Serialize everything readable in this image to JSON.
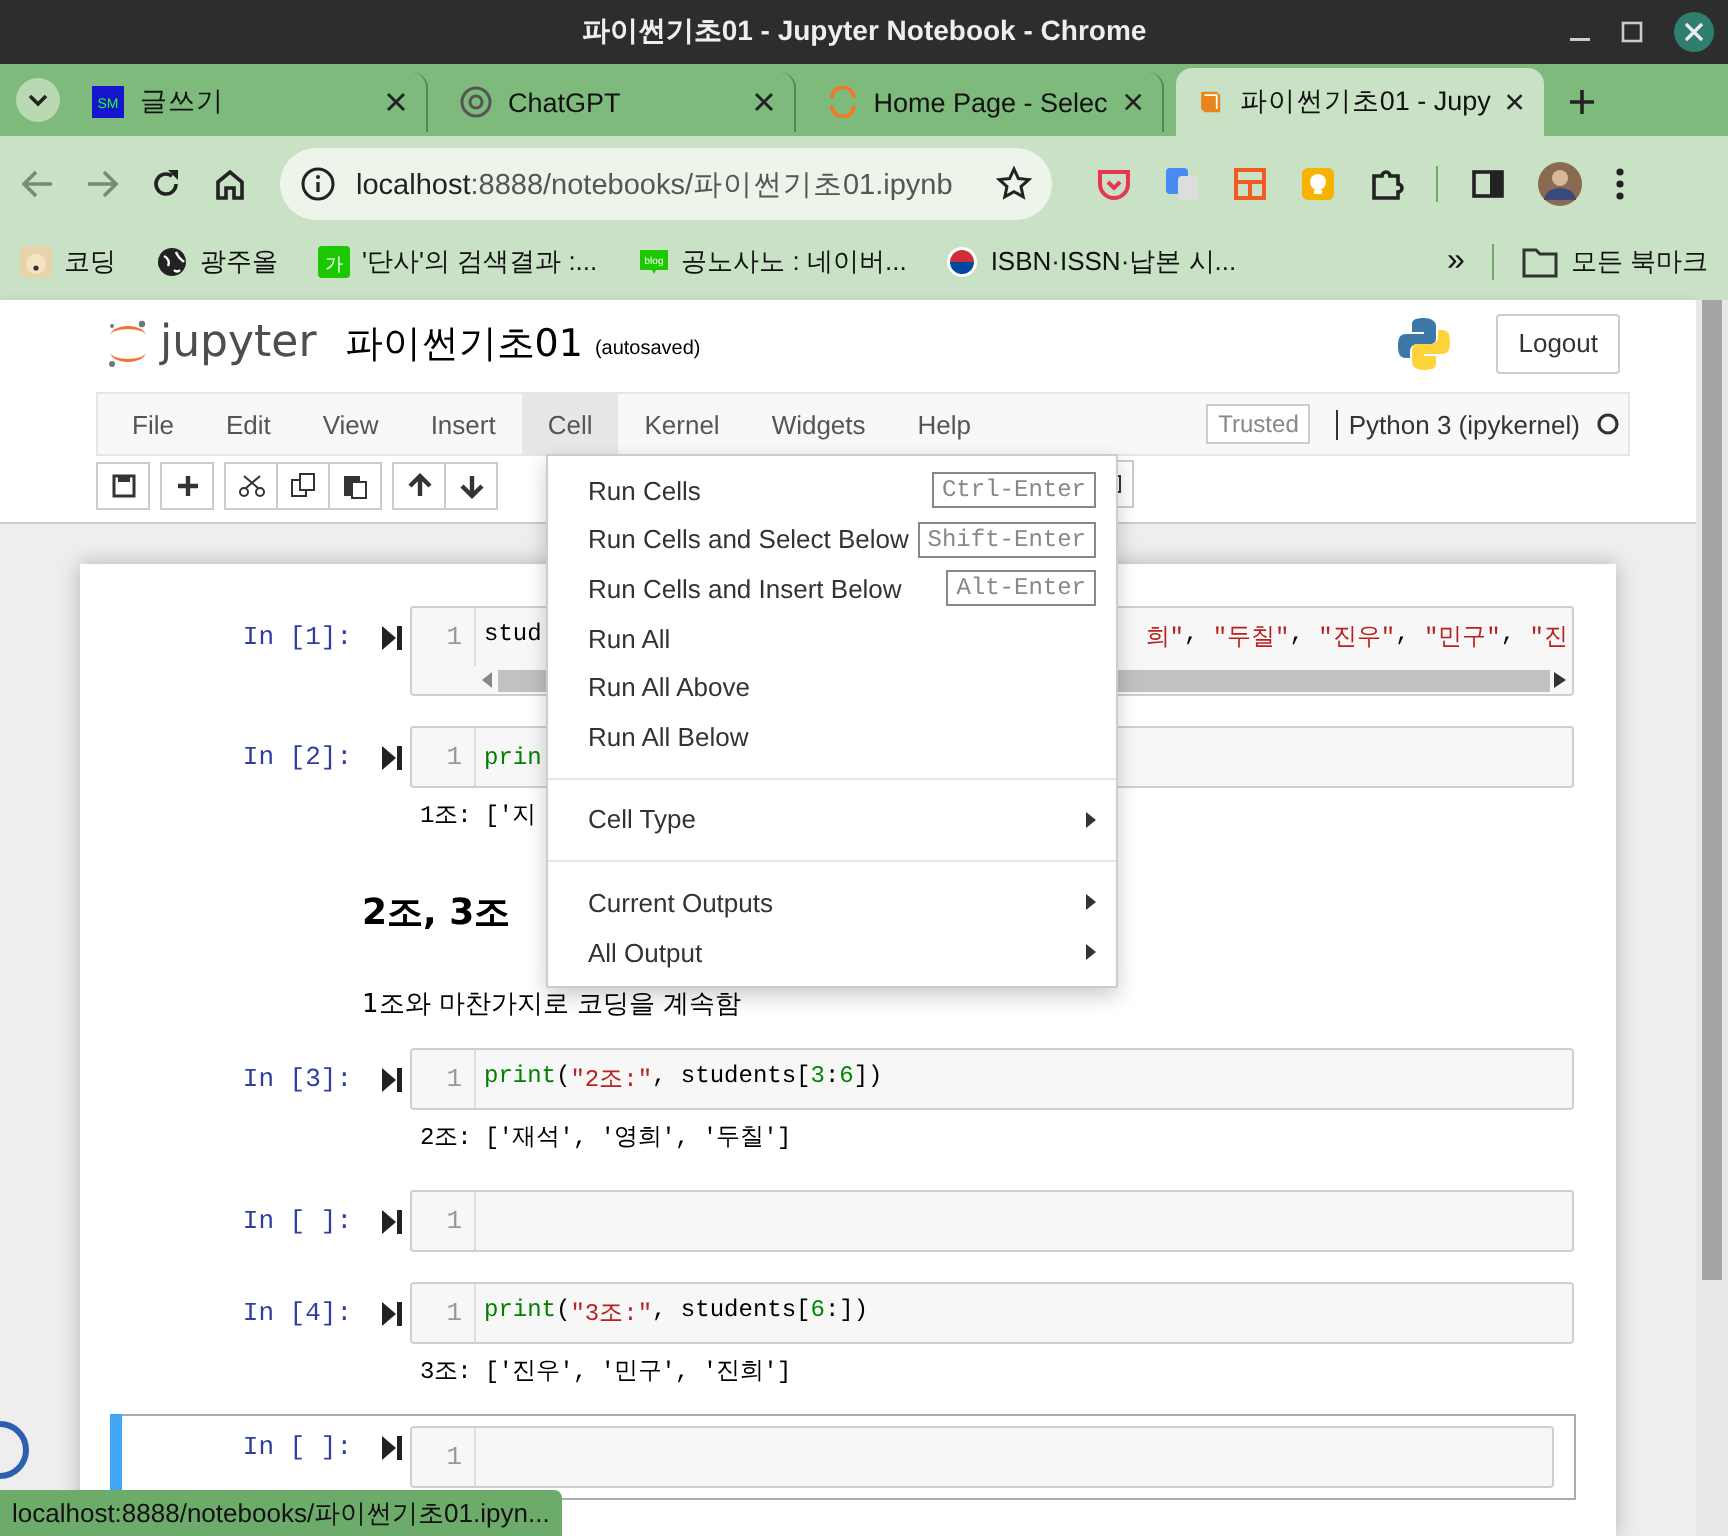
{
  "window": {
    "title": "파이썬기초01 - Jupyter Notebook - Chrome"
  },
  "tabs": [
    {
      "label": "글쓰기",
      "selected": false,
      "kind": "sm",
      "badge": "SM"
    },
    {
      "label": "ChatGPT",
      "selected": false,
      "kind": "knot"
    },
    {
      "label": "Home Page - Selec",
      "selected": false,
      "kind": "ring"
    },
    {
      "label": "파이썬기초01 - Jupy",
      "selected": true,
      "kind": "book"
    }
  ],
  "address": {
    "host": "localhost",
    "path": ":8888/notebooks/파이썬기초01.ipynb"
  },
  "bookmarks": [
    {
      "label": "코딩",
      "kind": "dog"
    },
    {
      "label": "광주올",
      "kind": "globe"
    },
    {
      "label": "'단사'의 검색결과 :...",
      "kind": "ga",
      "badge": "가"
    },
    {
      "label": "공노사노 : 네이버...",
      "kind": "blog",
      "badge": "blog"
    },
    {
      "label": "ISBN·ISSN·납본 시...",
      "kind": "flag"
    }
  ],
  "bookmark_overflow": "»",
  "bookmark_folder": "모든 북마크",
  "notebook": {
    "logo_text": "jupyter",
    "name": "파이썬기초01",
    "save_status": "(autosaved)",
    "logout": "Logout",
    "trusted": "Trusted",
    "kernel": "Python 3 (ipykernel)",
    "menus": [
      {
        "label": "File",
        "selected": false
      },
      {
        "label": "Edit",
        "selected": false
      },
      {
        "label": "View",
        "selected": false
      },
      {
        "label": "Insert",
        "selected": false
      },
      {
        "label": "Cell",
        "selected": true
      },
      {
        "label": "Kernel",
        "selected": false
      },
      {
        "label": "Widgets",
        "selected": false
      },
      {
        "label": "Help",
        "selected": false
      }
    ]
  },
  "cell_menu": [
    {
      "kind": "item",
      "label": "Run Cells",
      "shortcut": "Ctrl-Enter"
    },
    {
      "kind": "item",
      "label": "Run Cells and Select Below",
      "shortcut": "Shift-Enter"
    },
    {
      "kind": "item",
      "label": "Run Cells and Insert Below",
      "shortcut": "Alt-Enter"
    },
    {
      "kind": "item",
      "label": "Run All"
    },
    {
      "kind": "item",
      "label": "Run All Above"
    },
    {
      "kind": "item",
      "label": "Run All Below"
    },
    {
      "kind": "divider"
    },
    {
      "kind": "submenu",
      "label": "Cell Type"
    },
    {
      "kind": "divider"
    },
    {
      "kind": "submenu",
      "label": "Current Outputs"
    },
    {
      "kind": "submenu",
      "label": "All Output"
    }
  ],
  "cells": [
    {
      "kind": "code",
      "selected": false,
      "prompt": "In [1]:",
      "line": "1",
      "scrollbar": true,
      "code": [
        {
          "kind": "name",
          "text": "stud"
        }
      ],
      "code_right": [
        {
          "kind": "string",
          "text": "희\""
        },
        {
          "kind": "name",
          "text": ", "
        },
        {
          "kind": "string",
          "text": "\"두칠\""
        },
        {
          "kind": "name",
          "text": ", "
        },
        {
          "kind": "string",
          "text": "\"진우\""
        },
        {
          "kind": "name",
          "text": ", "
        },
        {
          "kind": "string",
          "text": "\"민구\""
        },
        {
          "kind": "name",
          "text": ", "
        },
        {
          "kind": "string",
          "text": "\"진"
        }
      ]
    },
    {
      "kind": "code",
      "selected": false,
      "prompt": "In [2]:",
      "line": "1",
      "code": [
        {
          "kind": "keyword",
          "text": "prin"
        }
      ],
      "output": "1조: ['지"
    },
    {
      "kind": "markdown",
      "selected": false,
      "heading": "2조, 3조",
      "text": "1조와 마찬가지로 코딩을 계속함"
    },
    {
      "kind": "code",
      "selected": false,
      "prompt": "In [3]:",
      "line": "1",
      "code": [
        {
          "kind": "keyword",
          "text": "print"
        },
        {
          "kind": "name",
          "text": "("
        },
        {
          "kind": "string",
          "text": "\"2조:\""
        },
        {
          "kind": "name",
          "text": ", students["
        },
        {
          "kind": "number",
          "text": "3"
        },
        {
          "kind": "name",
          "text": ":"
        },
        {
          "kind": "number",
          "text": "6"
        },
        {
          "kind": "name",
          "text": "])"
        }
      ],
      "output": "2조: ['재석', '영희', '두칠']"
    },
    {
      "kind": "code",
      "selected": false,
      "prompt": "In [ ]:",
      "line": "1"
    },
    {
      "kind": "code",
      "selected": false,
      "prompt": "In [4]:",
      "line": "1",
      "code": [
        {
          "kind": "keyword",
          "text": "print"
        },
        {
          "kind": "name",
          "text": "("
        },
        {
          "kind": "string",
          "text": "\"3조:\""
        },
        {
          "kind": "name",
          "text": ", students["
        },
        {
          "kind": "number",
          "text": "6"
        },
        {
          "kind": "name",
          "text": ":])"
        }
      ],
      "output": "3조: ['진우', '민구', '진희']"
    },
    {
      "kind": "code",
      "selected": true,
      "prompt": "In [ ]:",
      "line": "1"
    }
  ],
  "status_bubble": "localhost:8888/notebooks/파이썬기초01.ipyn..."
}
